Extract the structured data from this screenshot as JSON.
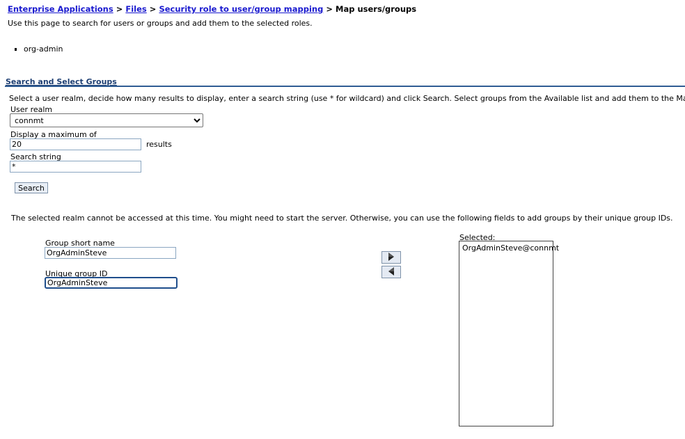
{
  "breadcrumb": {
    "items": [
      "Enterprise Applications",
      "Files",
      "Security role to user/group mapping"
    ],
    "separator": ">",
    "current": "Map users/groups"
  },
  "page_description": "Use this page to search for users or groups and add them to the selected roles.",
  "roles": [
    "org-admin"
  ],
  "search_section": {
    "title": "Search and Select Groups",
    "instructions": "Select a user realm, decide how many results to display, enter a search string (use * for wildcard) and click Search. Select groups from the Available list and add them to the Mapped to role lis",
    "user_realm_label": "User realm",
    "user_realm_value": "connmt",
    "display_max_label": "Display a maximum of",
    "display_max_value": "20",
    "results_label": "results",
    "search_string_label": "Search string",
    "search_string_value": "*",
    "search_button": "Search"
  },
  "realm_message": "The selected realm cannot be accessed at this time. You might need to start the server. Otherwise, you can use the following fields to add groups by their unique group IDs.",
  "manual_group": {
    "short_name_label": "Group short name",
    "short_name_value": "OrgAdminSteve",
    "unique_id_label": "Unique group ID",
    "unique_id_value": "OrgAdminSteve"
  },
  "arrows": {
    "add_icon": "arrow-right-icon",
    "remove_icon": "arrow-left-icon"
  },
  "selected": {
    "label": "Selected:",
    "items": [
      "OrgAdminSteve@connmt"
    ]
  },
  "colors": {
    "link": "#1a1acf",
    "section_title": "#1e3f73",
    "rule": "#2f5c93"
  }
}
